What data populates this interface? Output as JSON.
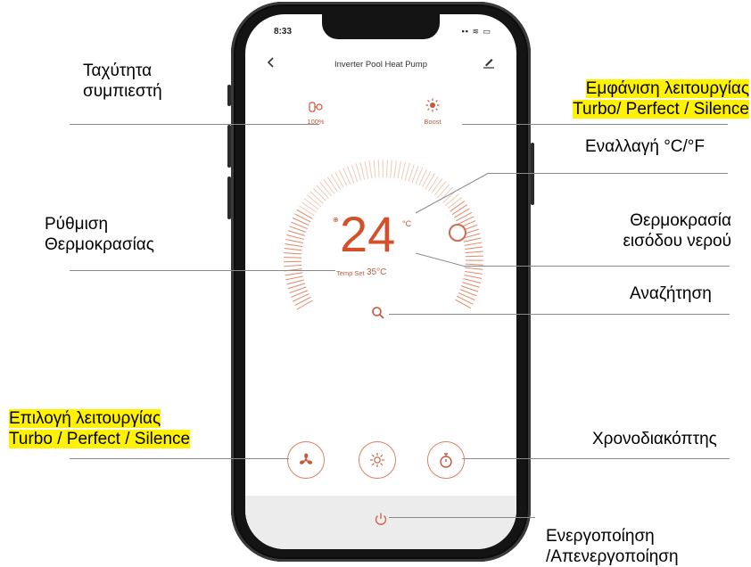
{
  "phone": {
    "status_time": "8:33",
    "status_icons": "▪▪ ≋ ▭",
    "nav_title": "Inverter Pool Heat Pump",
    "compressor_value": "100%",
    "mode_value": "Boost",
    "temperature": "24",
    "temperature_unit": "°C",
    "temp_set_label": "Temp Set",
    "temp_set_value": "35°C"
  },
  "annotations": {
    "compressor_speed": [
      "Ταχύτητα",
      "συμπιεστή"
    ],
    "mode_display": [
      "Εμφάνιση λειτουργίας",
      "Turbo/ Perfect / Silence"
    ],
    "unit_toggle": "Εναλλαγή  °C/°F",
    "temp_setting": [
      "Ρύθμιση",
      "Θερμοκρασίας"
    ],
    "inlet_temp": [
      "Θερμοκρασία",
      "εισόδου νερού"
    ],
    "search": "Αναζήτηση",
    "mode_select": [
      "Επιλογή λειτουργίας ",
      "Turbo / Perfect / Silence"
    ],
    "timer": "Χρονοδιακόπτης",
    "power": [
      "Ενεργοποίηση",
      "/Απενεργοποίηση"
    ]
  },
  "colors": {
    "accent": "#d4502a",
    "highlight": "#fff200",
    "phone_frame": "#141414"
  }
}
